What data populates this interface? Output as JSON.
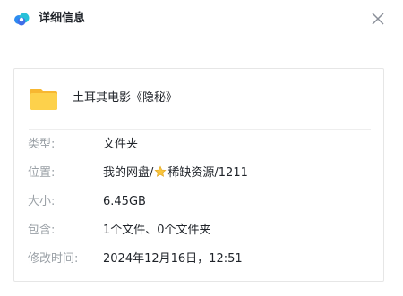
{
  "header": {
    "title": "详细信息",
    "logo_icon": "cloud-logo-icon",
    "close_icon": "close-icon"
  },
  "file": {
    "icon": "folder-icon",
    "name": "土耳其电影《隐秘》"
  },
  "details": {
    "type": {
      "label": "类型:",
      "value": "文件夹"
    },
    "location": {
      "label": "位置:",
      "value_prefix": "我的网盘/",
      "value_icon": "star-icon",
      "value_suffix": "稀缺资源/1211"
    },
    "size": {
      "label": "大小:",
      "value": "6.45GB"
    },
    "contains": {
      "label": "包含:",
      "value": "1个文件、0个文件夹"
    },
    "modified": {
      "label": "修改时间:",
      "value": "2024年12月16日，12:51"
    }
  },
  "colors": {
    "label": "#9aa0a6",
    "value": "#1f2329",
    "folder": "#f9c53c",
    "border": "#e6e6e6"
  }
}
